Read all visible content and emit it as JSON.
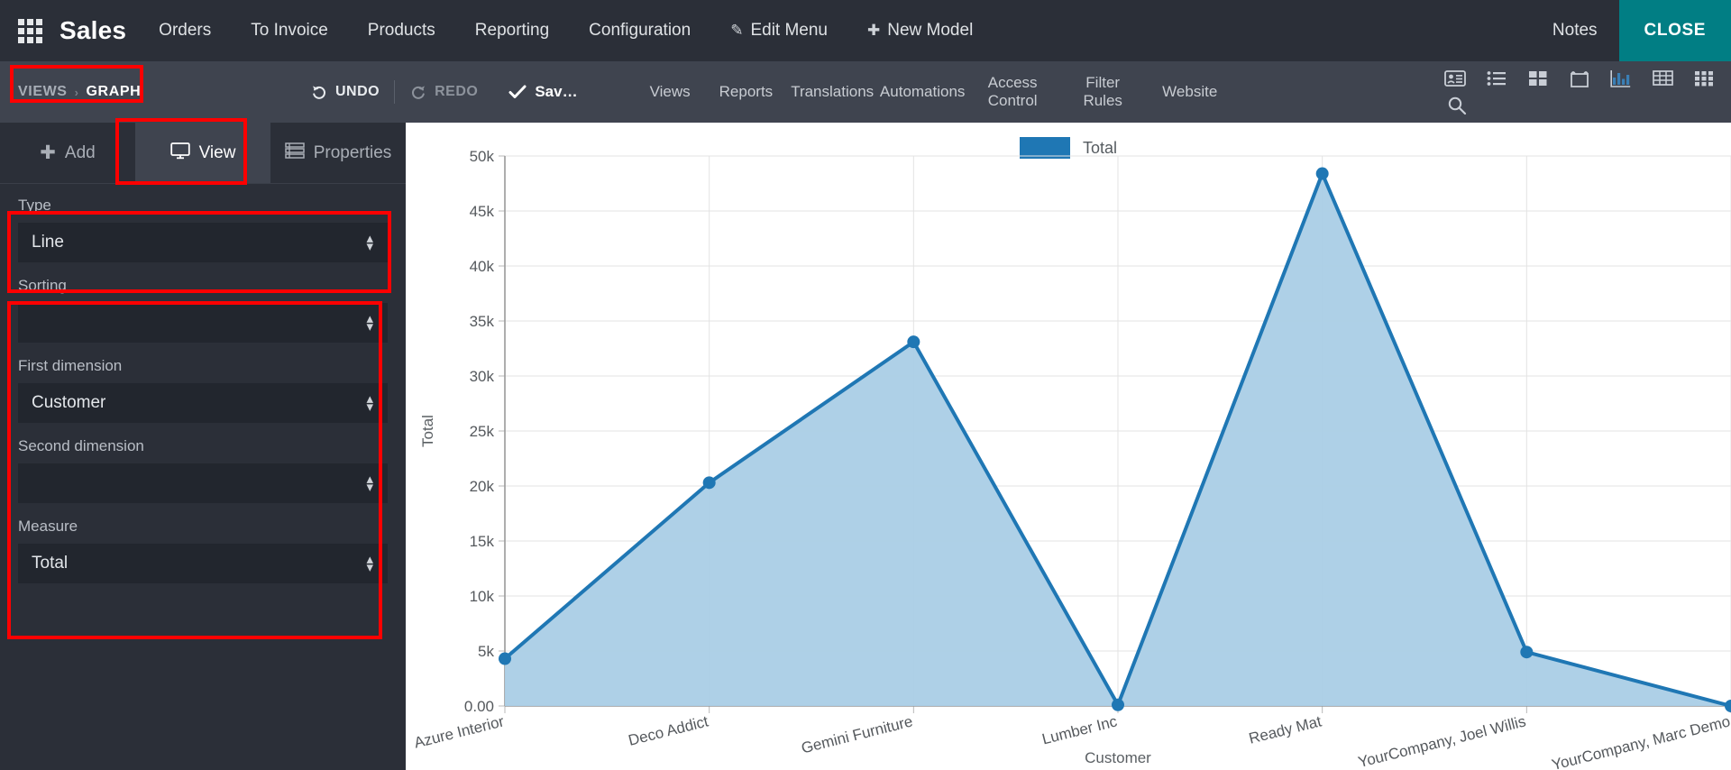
{
  "navbar": {
    "apps_icon": "apps-grid-icon",
    "brand": "Sales",
    "links": [
      "Orders",
      "To Invoice",
      "Products",
      "Reporting",
      "Configuration"
    ],
    "edit_menu": "Edit Menu",
    "new_model": "New Model",
    "notes": "Notes",
    "close": "CLOSE",
    "close_color": "#017e84"
  },
  "subbar": {
    "views_label": "VIEWS",
    "separator": "›",
    "graph_label": "GRAPH",
    "undo": "UNDO",
    "redo": "REDO",
    "save": "Sav…",
    "links": [
      "Views",
      "Reports",
      "Translations",
      "Automations",
      "Access Control",
      "Filter Rules",
      "Website"
    ],
    "view_icons": [
      "contact-card-icon",
      "list-icon",
      "kanban-icon",
      "calendar-icon",
      "graph-icon",
      "pivot-icon",
      "grid-icon"
    ],
    "search_icon": "search-icon"
  },
  "sidebar": {
    "tabs": [
      {
        "label": "Add",
        "icon": "plus-icon",
        "active": false
      },
      {
        "label": "View",
        "icon": "monitor-icon",
        "active": true
      },
      {
        "label": "Properties",
        "icon": "properties-icon",
        "active": false
      }
    ],
    "fields": [
      {
        "label": "Type",
        "value": "Line"
      },
      {
        "label": "Sorting",
        "value": ""
      },
      {
        "label": "First dimension",
        "value": "Customer"
      },
      {
        "label": "Second dimension",
        "value": ""
      },
      {
        "label": "Measure",
        "value": "Total"
      }
    ]
  },
  "chart_data": {
    "type": "area",
    "title": "",
    "xlabel": "Customer",
    "ylabel": "Total",
    "legend": [
      "Total"
    ],
    "legend_position": "top-center",
    "grid": true,
    "series_color": "#1f77b4",
    "fill_color": "#aacee6",
    "categories": [
      "Azure Interior",
      "Deco Addict",
      "Gemini Furniture",
      "Lumber Inc",
      "Ready Mat",
      "YourCompany, Joel Willis",
      "YourCompany, Marc Demo"
    ],
    "values": [
      4300,
      20300,
      33100,
      100,
      48400,
      4900,
      0
    ],
    "ylim": [
      0,
      50000
    ],
    "yticks": [
      0,
      5000,
      10000,
      15000,
      20000,
      25000,
      30000,
      35000,
      40000,
      45000,
      50000
    ],
    "ytick_labels": [
      "0.00",
      "5k",
      "10k",
      "15k",
      "20k",
      "25k",
      "30k",
      "35k",
      "40k",
      "45k",
      "50k"
    ]
  }
}
